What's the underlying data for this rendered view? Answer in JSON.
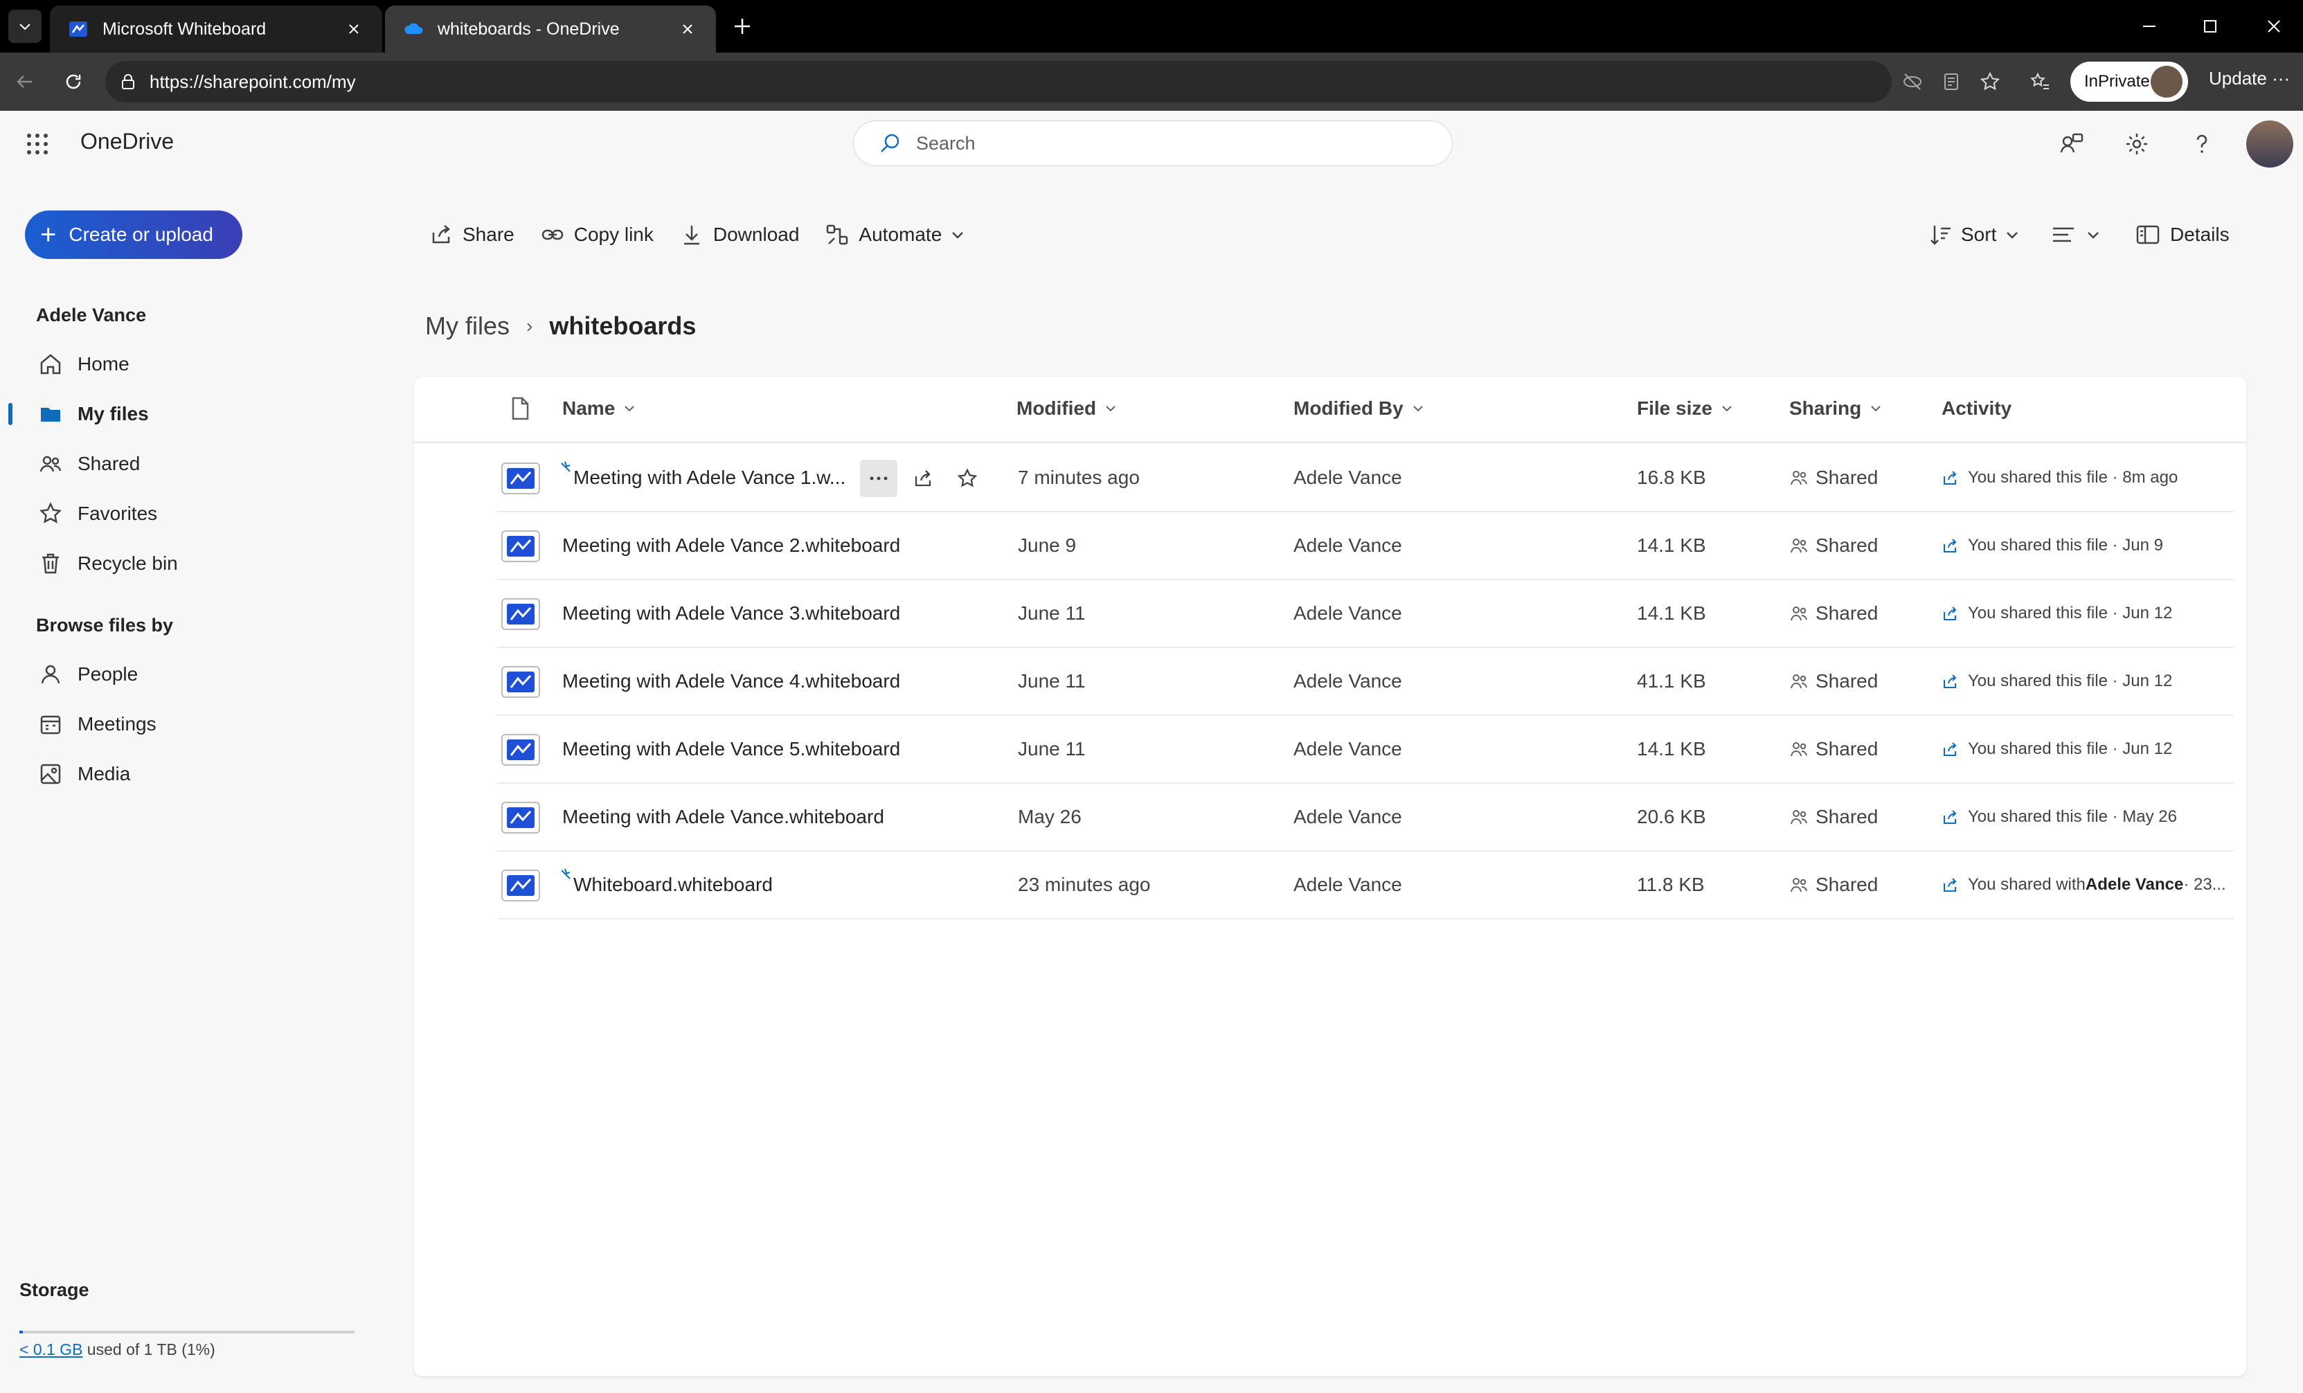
{
  "browser": {
    "tabs": [
      {
        "title": "Microsoft Whiteboard"
      },
      {
        "title": "whiteboards - OneDrive"
      }
    ],
    "url": "https://sharepoint.com/my",
    "inprivate_label": "InPrivate",
    "update_label": "Update"
  },
  "app": {
    "name": "OneDrive",
    "search_placeholder": "Search",
    "create_label": "Create or upload"
  },
  "commands": {
    "share": "Share",
    "copy_link": "Copy link",
    "download": "Download",
    "automate": "Automate",
    "sort": "Sort",
    "details": "Details"
  },
  "sidebar": {
    "user": "Adele Vance",
    "items": [
      {
        "label": "Home",
        "icon": "home-icon"
      },
      {
        "label": "My files",
        "icon": "folder-icon"
      },
      {
        "label": "Shared",
        "icon": "people-icon"
      },
      {
        "label": "Favorites",
        "icon": "star-icon"
      },
      {
        "label": "Recycle bin",
        "icon": "trash-icon"
      }
    ],
    "browse_heading": "Browse files by",
    "browse_items": [
      {
        "label": "People",
        "icon": "person-icon"
      },
      {
        "label": "Meetings",
        "icon": "calendar-icon"
      },
      {
        "label": "Media",
        "icon": "image-icon"
      }
    ],
    "storage": {
      "title": "Storage",
      "used_link": "< 0.1 GB",
      "used_text": " used of 1 TB (1%)",
      "percent": 1
    }
  },
  "breadcrumb": {
    "parent": "My files",
    "current": "whiteboards"
  },
  "table": {
    "columns": {
      "name": "Name",
      "modified": "Modified",
      "modified_by": "Modified By",
      "file_size": "File size",
      "sharing": "Sharing",
      "activity": "Activity"
    },
    "rows": [
      {
        "name": "Meeting with Adele Vance 1.w...",
        "modified": "7 minutes ago",
        "modified_by": "Adele Vance",
        "size": "16.8 KB",
        "sharing": "Shared",
        "activity": "You shared this file · 8m ago",
        "activity_bold": "",
        "activity_tail": "",
        "is_new": true
      },
      {
        "name": "Meeting with Adele Vance 2.whiteboard",
        "modified": "June 9",
        "modified_by": "Adele Vance",
        "size": "14.1 KB",
        "sharing": "Shared",
        "activity": "You shared this file · Jun 9",
        "activity_bold": "",
        "activity_tail": "",
        "is_new": false
      },
      {
        "name": "Meeting with Adele Vance 3.whiteboard",
        "modified": "June 11",
        "modified_by": "Adele Vance",
        "size": "14.1 KB",
        "sharing": "Shared",
        "activity": "You shared this file · Jun 12",
        "activity_bold": "",
        "activity_tail": "",
        "is_new": false
      },
      {
        "name": "Meeting with Adele Vance 4.whiteboard",
        "modified": "June 11",
        "modified_by": "Adele Vance",
        "size": "41.1 KB",
        "sharing": "Shared",
        "activity": "You shared this file · Jun 12",
        "activity_bold": "",
        "activity_tail": "",
        "is_new": false
      },
      {
        "name": "Meeting with Adele Vance 5.whiteboard",
        "modified": "June 11",
        "modified_by": "Adele Vance",
        "size": "14.1 KB",
        "sharing": "Shared",
        "activity": "You shared this file · Jun 12",
        "activity_bold": "",
        "activity_tail": "",
        "is_new": false
      },
      {
        "name": "Meeting with Adele Vance.whiteboard",
        "modified": "May 26",
        "modified_by": "Adele Vance",
        "size": "20.6 KB",
        "sharing": "Shared",
        "activity": "You shared this file · May 26",
        "activity_bold": "",
        "activity_tail": "",
        "is_new": false
      },
      {
        "name": "Whiteboard.whiteboard",
        "modified": "23 minutes ago",
        "modified_by": "Adele Vance",
        "size": "11.8 KB",
        "sharing": "Shared",
        "activity": "You shared with ",
        "activity_bold": "Adele Vance",
        "activity_tail": " · 23...",
        "is_new": true
      }
    ]
  },
  "colors": {
    "accent": "#0f6cbd",
    "create_gradient_start": "#1a5fd1",
    "create_gradient_end": "#3a3fb6"
  }
}
